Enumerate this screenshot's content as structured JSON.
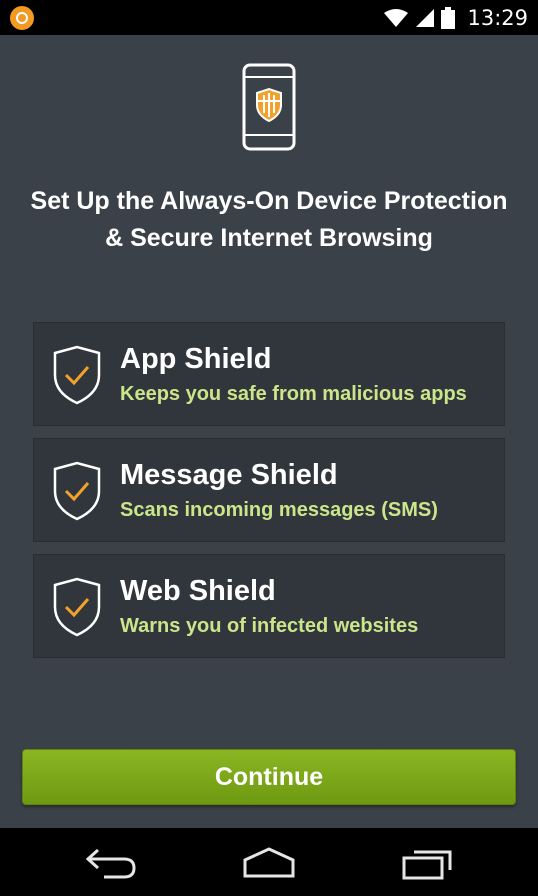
{
  "status_bar": {
    "time": "13:29",
    "icons": [
      "app-notification-icon",
      "wifi-icon",
      "signal-icon",
      "battery-icon"
    ]
  },
  "main": {
    "hero_icon": "phone-shield-icon",
    "headline_line1": "Set Up the Always-On Device Protection",
    "headline_line2": "& Secure Internet Browsing",
    "shields": [
      {
        "title": "App Shield",
        "subtitle": "Keeps you safe from malicious apps",
        "icon": "shield-check-icon"
      },
      {
        "title": "Message Shield",
        "subtitle": "Scans incoming messages (SMS)",
        "icon": "shield-check-icon"
      },
      {
        "title": "Web Shield",
        "subtitle": "Warns you of infected websites",
        "icon": "shield-check-icon"
      }
    ],
    "continue_label": "Continue"
  },
  "nav_bar": {
    "buttons": [
      "back-icon",
      "home-icon",
      "recent-apps-icon"
    ]
  },
  "colors": {
    "background": "#3b4148",
    "card": "#31363c",
    "accent_green": "#7aa61a",
    "subtitle_green": "#cbe58a",
    "check_orange": "#f3a12b"
  }
}
